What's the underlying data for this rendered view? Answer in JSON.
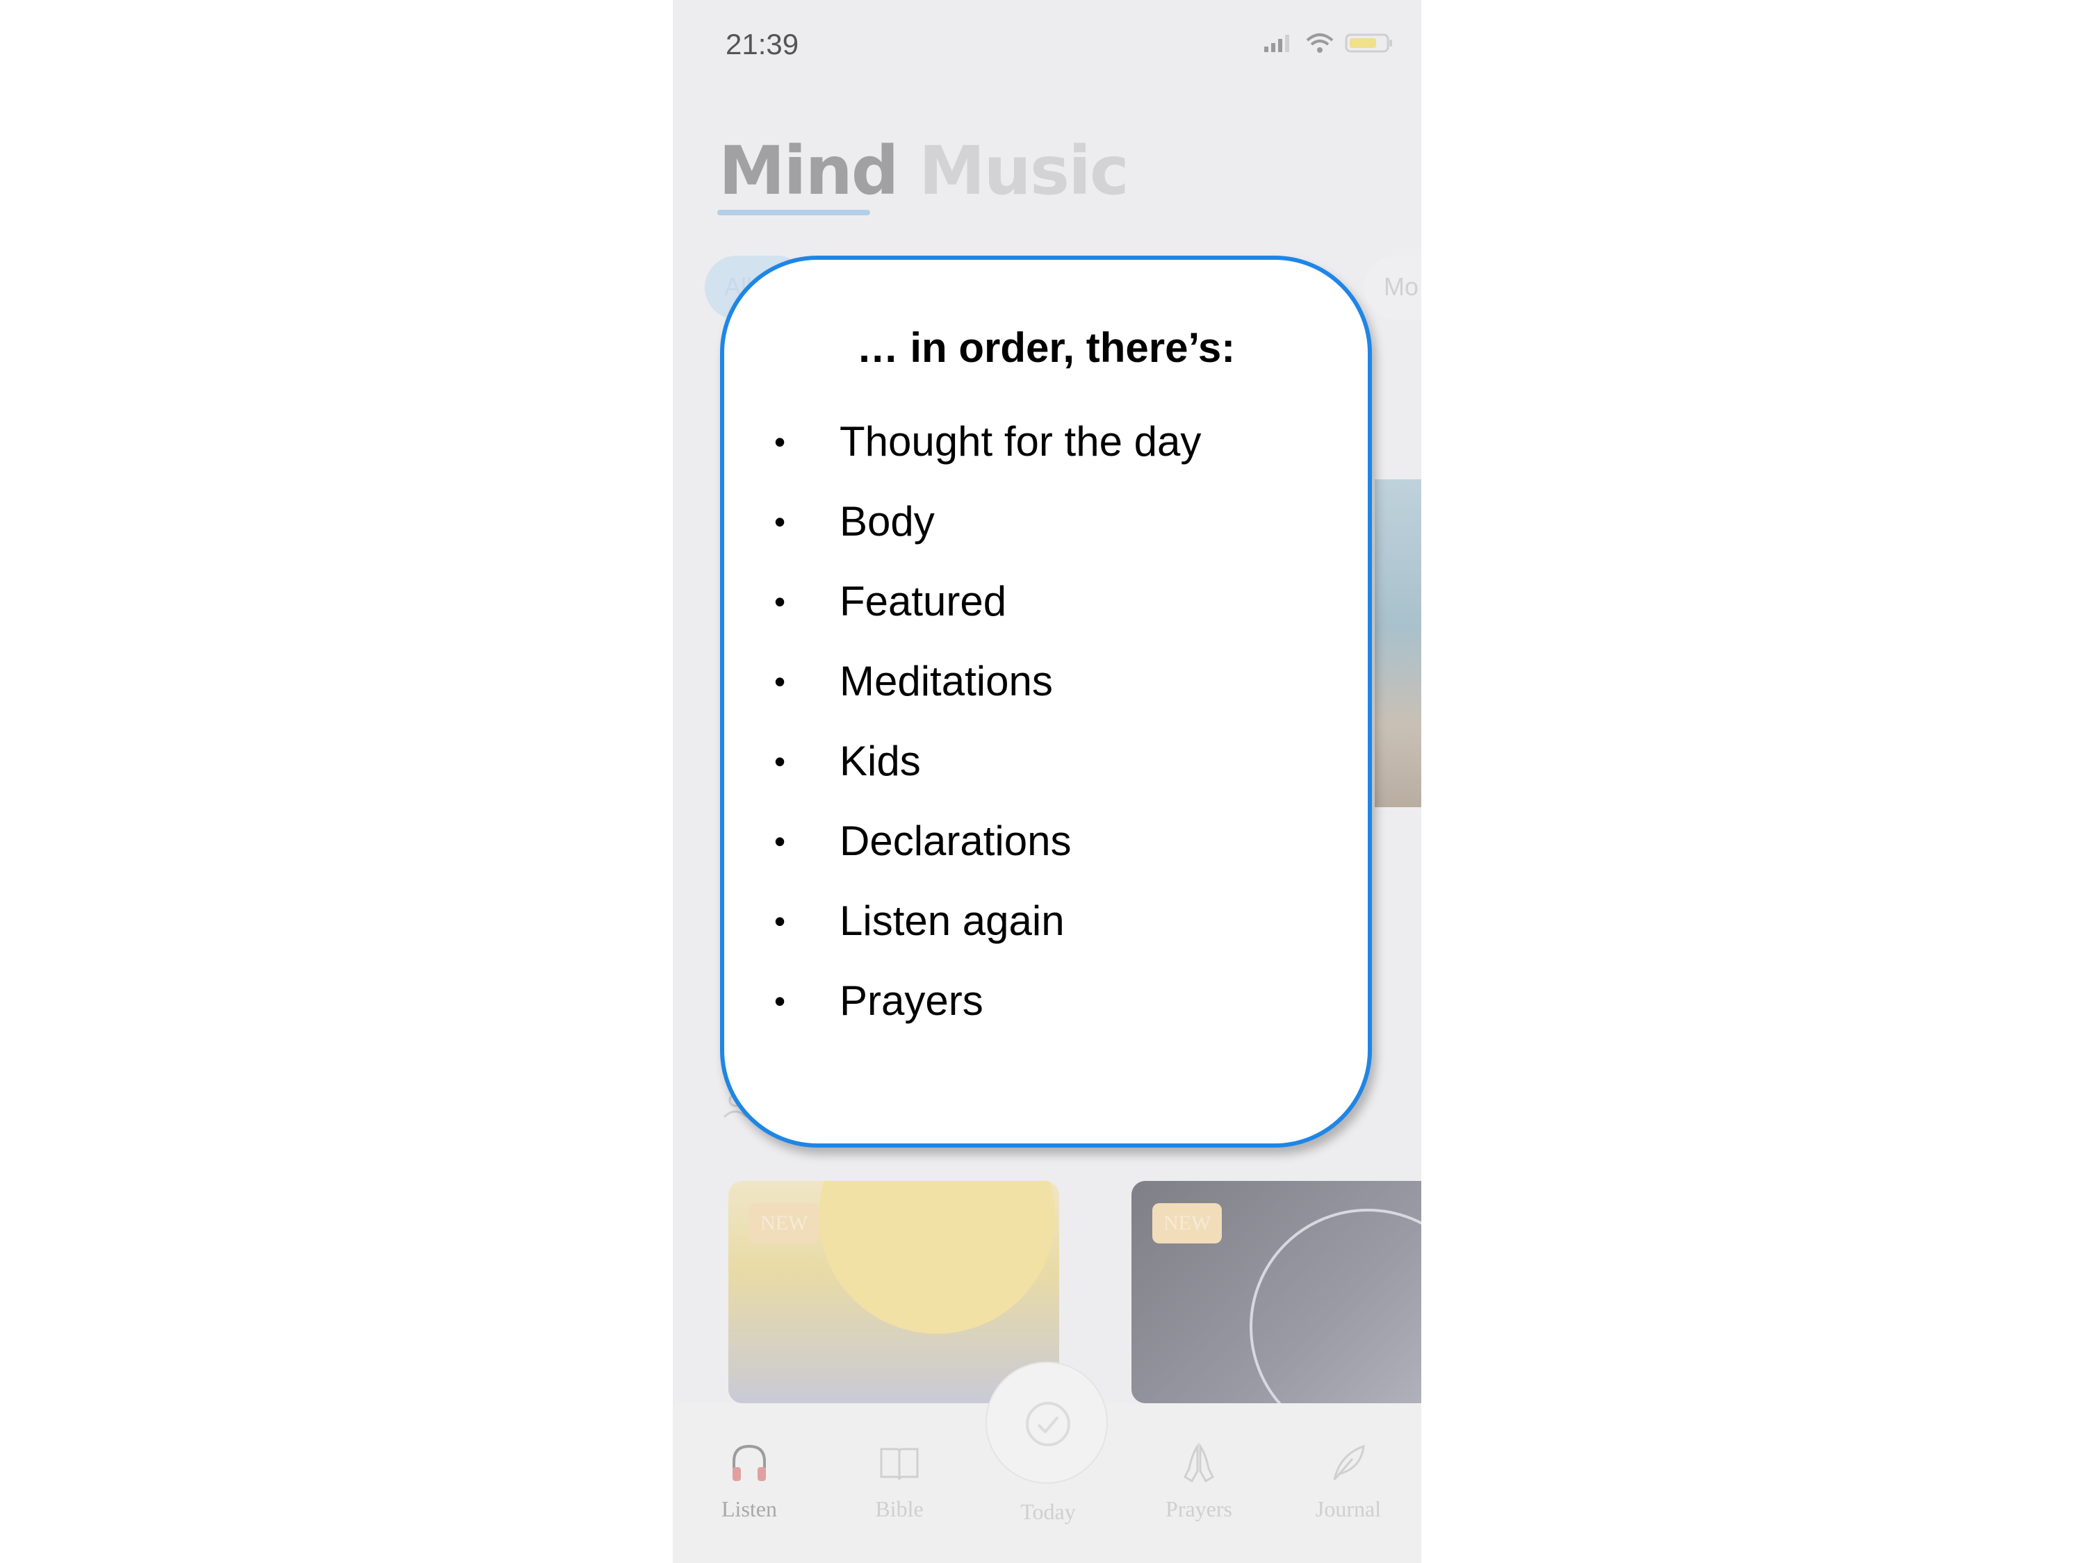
{
  "status_bar": {
    "time": "21:39"
  },
  "tabs": [
    {
      "label": "Mind"
    },
    {
      "label": "Music"
    }
  ],
  "chips": [
    {
      "label": "All"
    },
    {
      "label": "Mo"
    }
  ],
  "cards": [
    {
      "badge": "NEW"
    },
    {
      "badge": "NEW"
    }
  ],
  "bottom_nav": [
    {
      "label": "Listen",
      "icon": "headphones-icon"
    },
    {
      "label": "Bible",
      "icon": "book-icon"
    },
    {
      "label": "Today",
      "icon": "check-circle-icon"
    },
    {
      "label": "Prayers",
      "icon": "praying-hands-icon"
    },
    {
      "label": "Journal",
      "icon": "feather-icon"
    }
  ],
  "callout": {
    "heading": "… in order, there’s:",
    "bullet": "•",
    "items": [
      "Thought for the day",
      "Body",
      "Featured",
      "Meditations",
      "Kids",
      "Declarations",
      "Listen again",
      "Prayers"
    ]
  },
  "colors": {
    "callout_border": "#1e86e6",
    "tab_underline": "#b3cfe8",
    "listen_icon_accent": "#e0a0a0"
  }
}
